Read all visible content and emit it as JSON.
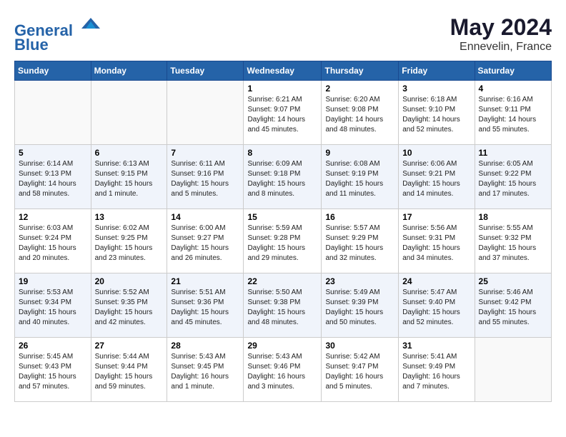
{
  "header": {
    "logo_line1": "General",
    "logo_line2": "Blue",
    "month": "May 2024",
    "location": "Ennevelin, France"
  },
  "weekdays": [
    "Sunday",
    "Monday",
    "Tuesday",
    "Wednesday",
    "Thursday",
    "Friday",
    "Saturday"
  ],
  "weeks": [
    [
      {
        "day": "",
        "info": ""
      },
      {
        "day": "",
        "info": ""
      },
      {
        "day": "",
        "info": ""
      },
      {
        "day": "1",
        "info": "Sunrise: 6:21 AM\nSunset: 9:07 PM\nDaylight: 14 hours\nand 45 minutes."
      },
      {
        "day": "2",
        "info": "Sunrise: 6:20 AM\nSunset: 9:08 PM\nDaylight: 14 hours\nand 48 minutes."
      },
      {
        "day": "3",
        "info": "Sunrise: 6:18 AM\nSunset: 9:10 PM\nDaylight: 14 hours\nand 52 minutes."
      },
      {
        "day": "4",
        "info": "Sunrise: 6:16 AM\nSunset: 9:11 PM\nDaylight: 14 hours\nand 55 minutes."
      }
    ],
    [
      {
        "day": "5",
        "info": "Sunrise: 6:14 AM\nSunset: 9:13 PM\nDaylight: 14 hours\nand 58 minutes."
      },
      {
        "day": "6",
        "info": "Sunrise: 6:13 AM\nSunset: 9:15 PM\nDaylight: 15 hours\nand 1 minute."
      },
      {
        "day": "7",
        "info": "Sunrise: 6:11 AM\nSunset: 9:16 PM\nDaylight: 15 hours\nand 5 minutes."
      },
      {
        "day": "8",
        "info": "Sunrise: 6:09 AM\nSunset: 9:18 PM\nDaylight: 15 hours\nand 8 minutes."
      },
      {
        "day": "9",
        "info": "Sunrise: 6:08 AM\nSunset: 9:19 PM\nDaylight: 15 hours\nand 11 minutes."
      },
      {
        "day": "10",
        "info": "Sunrise: 6:06 AM\nSunset: 9:21 PM\nDaylight: 15 hours\nand 14 minutes."
      },
      {
        "day": "11",
        "info": "Sunrise: 6:05 AM\nSunset: 9:22 PM\nDaylight: 15 hours\nand 17 minutes."
      }
    ],
    [
      {
        "day": "12",
        "info": "Sunrise: 6:03 AM\nSunset: 9:24 PM\nDaylight: 15 hours\nand 20 minutes."
      },
      {
        "day": "13",
        "info": "Sunrise: 6:02 AM\nSunset: 9:25 PM\nDaylight: 15 hours\nand 23 minutes."
      },
      {
        "day": "14",
        "info": "Sunrise: 6:00 AM\nSunset: 9:27 PM\nDaylight: 15 hours\nand 26 minutes."
      },
      {
        "day": "15",
        "info": "Sunrise: 5:59 AM\nSunset: 9:28 PM\nDaylight: 15 hours\nand 29 minutes."
      },
      {
        "day": "16",
        "info": "Sunrise: 5:57 AM\nSunset: 9:29 PM\nDaylight: 15 hours\nand 32 minutes."
      },
      {
        "day": "17",
        "info": "Sunrise: 5:56 AM\nSunset: 9:31 PM\nDaylight: 15 hours\nand 34 minutes."
      },
      {
        "day": "18",
        "info": "Sunrise: 5:55 AM\nSunset: 9:32 PM\nDaylight: 15 hours\nand 37 minutes."
      }
    ],
    [
      {
        "day": "19",
        "info": "Sunrise: 5:53 AM\nSunset: 9:34 PM\nDaylight: 15 hours\nand 40 minutes."
      },
      {
        "day": "20",
        "info": "Sunrise: 5:52 AM\nSunset: 9:35 PM\nDaylight: 15 hours\nand 42 minutes."
      },
      {
        "day": "21",
        "info": "Sunrise: 5:51 AM\nSunset: 9:36 PM\nDaylight: 15 hours\nand 45 minutes."
      },
      {
        "day": "22",
        "info": "Sunrise: 5:50 AM\nSunset: 9:38 PM\nDaylight: 15 hours\nand 48 minutes."
      },
      {
        "day": "23",
        "info": "Sunrise: 5:49 AM\nSunset: 9:39 PM\nDaylight: 15 hours\nand 50 minutes."
      },
      {
        "day": "24",
        "info": "Sunrise: 5:47 AM\nSunset: 9:40 PM\nDaylight: 15 hours\nand 52 minutes."
      },
      {
        "day": "25",
        "info": "Sunrise: 5:46 AM\nSunset: 9:42 PM\nDaylight: 15 hours\nand 55 minutes."
      }
    ],
    [
      {
        "day": "26",
        "info": "Sunrise: 5:45 AM\nSunset: 9:43 PM\nDaylight: 15 hours\nand 57 minutes."
      },
      {
        "day": "27",
        "info": "Sunrise: 5:44 AM\nSunset: 9:44 PM\nDaylight: 15 hours\nand 59 minutes."
      },
      {
        "day": "28",
        "info": "Sunrise: 5:43 AM\nSunset: 9:45 PM\nDaylight: 16 hours\nand 1 minute."
      },
      {
        "day": "29",
        "info": "Sunrise: 5:43 AM\nSunset: 9:46 PM\nDaylight: 16 hours\nand 3 minutes."
      },
      {
        "day": "30",
        "info": "Sunrise: 5:42 AM\nSunset: 9:47 PM\nDaylight: 16 hours\nand 5 minutes."
      },
      {
        "day": "31",
        "info": "Sunrise: 5:41 AM\nSunset: 9:49 PM\nDaylight: 16 hours\nand 7 minutes."
      },
      {
        "day": "",
        "info": ""
      }
    ]
  ]
}
